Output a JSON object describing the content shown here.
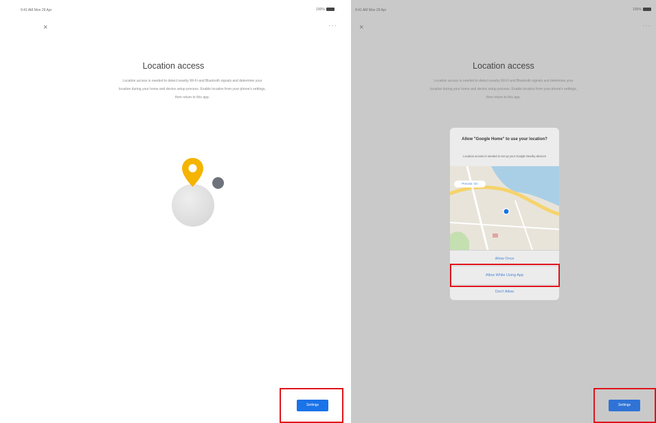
{
  "left": {
    "status_time": "9:41 AM  Mon 29 Apr",
    "status_battery": "100%",
    "close_label": "×",
    "more_label": "···",
    "title": "Location access",
    "body_line1": "Location access is needed to detect nearby Wi-Fi and Bluetooth signals and determine your",
    "body_line2": "location during your home and device setup process. Enable location from your phone's settings,",
    "body_line3": "then return to this app.",
    "settings_button": "Settings"
  },
  "right": {
    "status_time": "9:41 AM  Mon 29 Apr",
    "status_battery": "100%",
    "close_label": "×",
    "more_label": "···",
    "title": "Location access",
    "body_line1": "Location access is needed to detect nearby Wi-Fi and Bluetooth signals and determine your",
    "body_line2": "location during your home and device setup process. Enable location from your phone's settings,",
    "body_line3": "then return to this app.",
    "settings_button": "Settings",
    "dialog": {
      "title": "Allow \"Google Home\" to use your location?",
      "message": "Location access is needed to set up your Google Nearby devices",
      "map_chip": "Precise: On",
      "allow_once": "Allow Once",
      "allow_while_using": "Allow While Using App",
      "dont_allow": "Don't Allow"
    }
  },
  "colors": {
    "accent_blue": "#1a73e8",
    "highlight_red": "#e0131a",
    "pin_yellow": "#f4b400",
    "dim_background": "#c9c9c9"
  }
}
